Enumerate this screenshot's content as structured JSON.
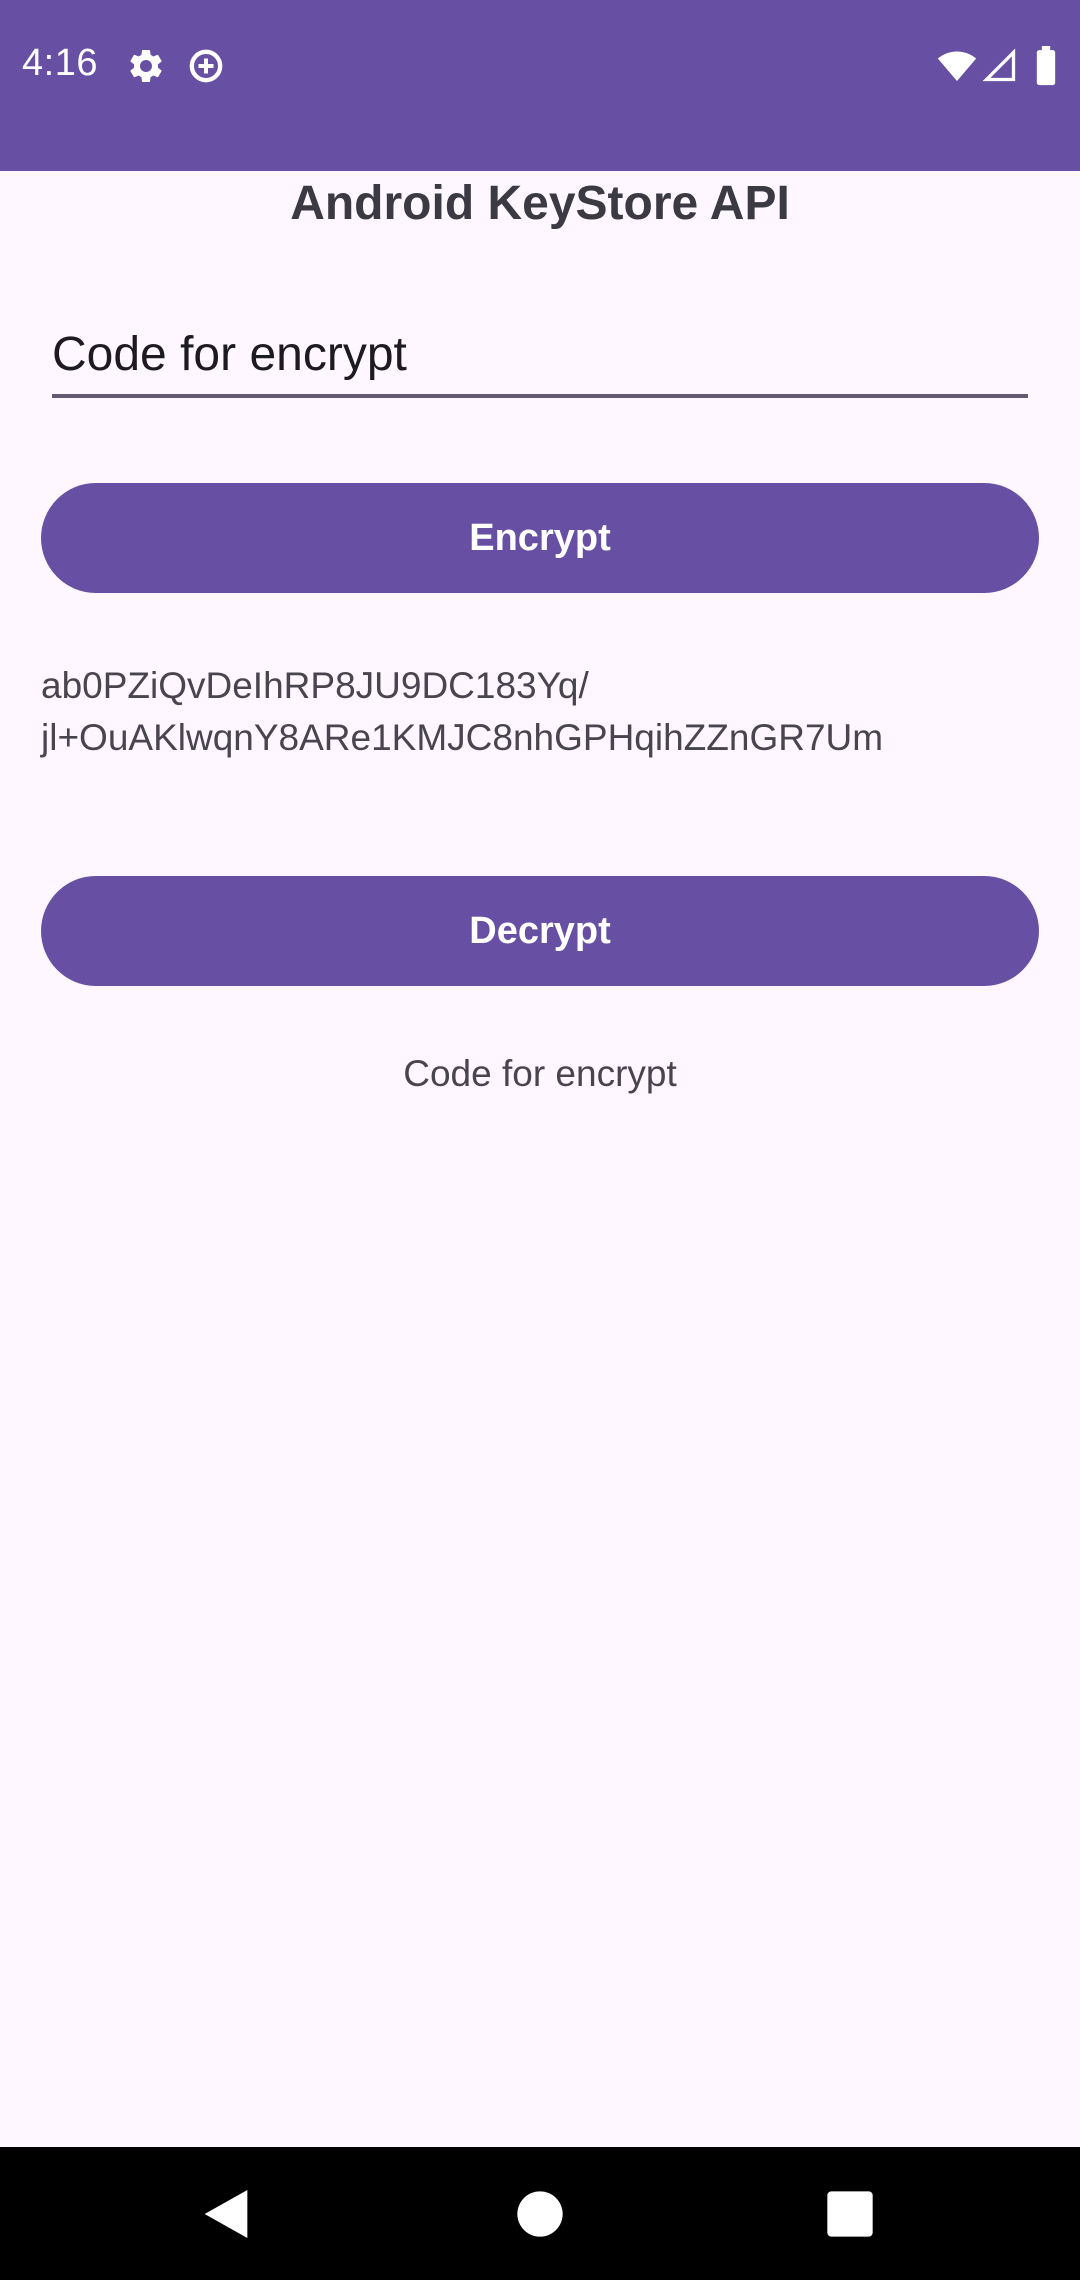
{
  "status_bar": {
    "time": "4:16",
    "left_icons": [
      "settings-gear-icon",
      "data-saver-icon"
    ],
    "right_icons": [
      "wifi-icon",
      "cell-signal-icon",
      "battery-icon"
    ],
    "color": "#6750A4"
  },
  "header": {
    "title": "Android KeyStore API"
  },
  "input": {
    "value": "Code for encrypt",
    "placeholder": ""
  },
  "actions": {
    "encrypt_label": "Encrypt",
    "decrypt_label": "Decrypt"
  },
  "output": {
    "cipher_line1": "ab0PZiQvDeIhRP8JU9DC183Yq/",
    "cipher_line2": "jl+OuAKlwqnY8ARe1KMJC8nhGPHqihZZnGR7Um",
    "decrypted": "Code for encrypt"
  },
  "nav_bar": {
    "buttons": [
      "back-icon",
      "home-icon",
      "recents-icon"
    ]
  },
  "colors": {
    "accent": "#6750A4",
    "background": "#FEF7FF",
    "text": "#49454F"
  }
}
